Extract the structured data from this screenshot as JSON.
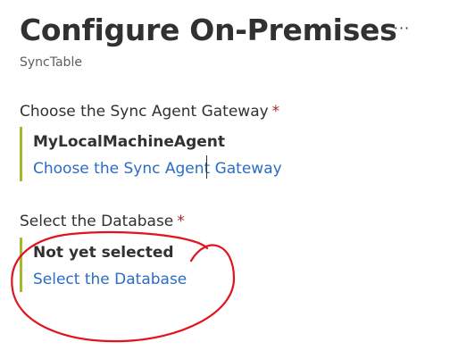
{
  "header": {
    "title": "Configure On-Premises",
    "more_label": "···",
    "subtitle": "SyncTable"
  },
  "gateway": {
    "label": "Choose the Sync Agent Gateway",
    "required_mark": "*",
    "value": "MyLocalMachineAgent",
    "link": "Choose the Sync Agent Gateway"
  },
  "database": {
    "label": "Select the Database",
    "required_mark": "*",
    "value": "Not yet selected",
    "link": "Select the Database"
  },
  "colors": {
    "accent_bar": "#a4b82c",
    "link": "#2b6cc4",
    "required": "#a4262c",
    "annotation": "#e0141e"
  }
}
